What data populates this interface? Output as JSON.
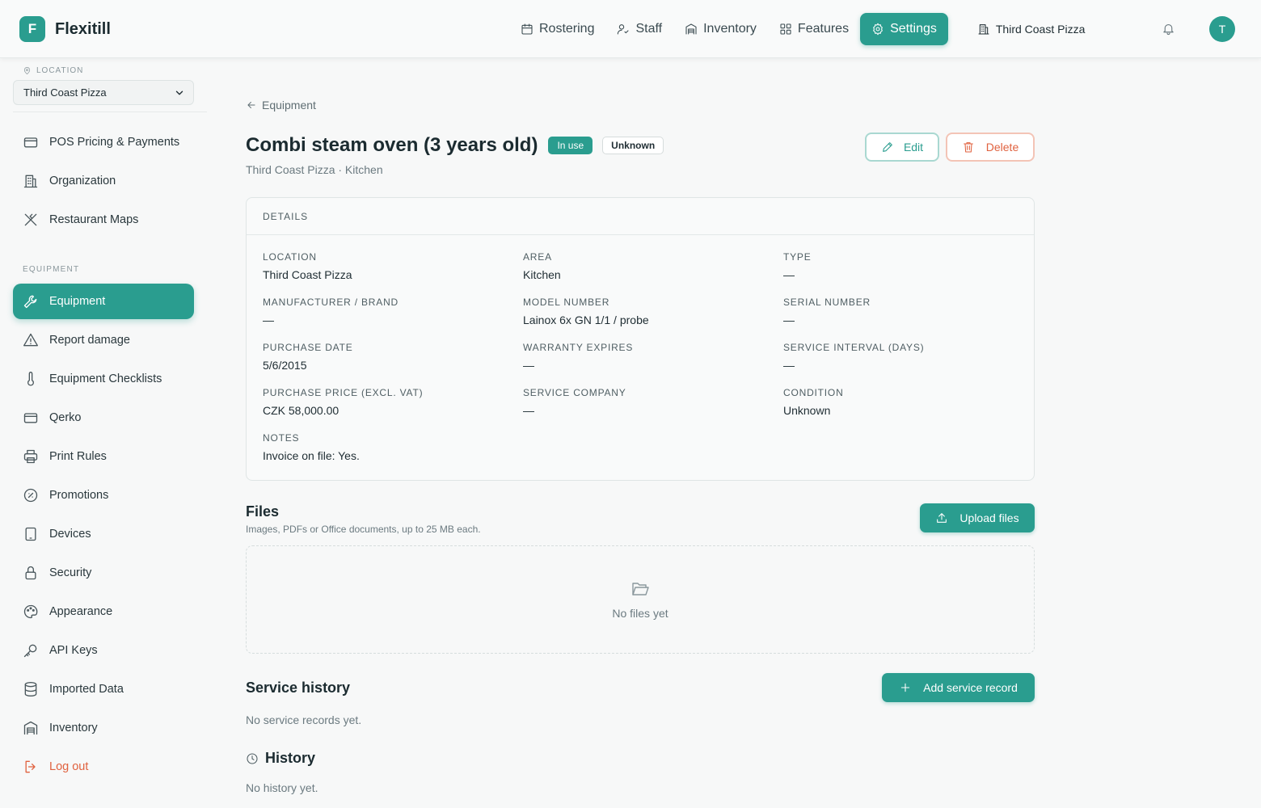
{
  "header": {
    "brand_initial": "F",
    "brand_name": "Flexitill",
    "nav": [
      {
        "label": "Rostering",
        "icon": "calendar-icon"
      },
      {
        "label": "Staff",
        "icon": "staff-icon"
      },
      {
        "label": "Inventory",
        "icon": "warehouse-icon"
      },
      {
        "label": "Features",
        "icon": "grid-icon"
      },
      {
        "label": "Settings",
        "icon": "gear-icon",
        "active": true
      }
    ],
    "location": "Third Coast Pizza",
    "avatar_initial": "T"
  },
  "sidebar": {
    "location_label": "LOCATION",
    "location_value": "Third Coast Pizza",
    "section_label": "EQUIPMENT",
    "items": [
      {
        "label": "POS Pricing & Payments",
        "icon": "credit-card-icon"
      },
      {
        "label": "Organization",
        "icon": "building-icon"
      },
      {
        "label": "Restaurant Maps",
        "icon": "utensils-icon"
      },
      {
        "label": "Equipment",
        "icon": "wrench-icon",
        "active": true
      },
      {
        "label": "Report damage",
        "icon": "warning-icon"
      },
      {
        "label": "Equipment Checklists",
        "icon": "thermometer-icon"
      },
      {
        "label": "Qerko",
        "icon": "card-icon"
      },
      {
        "label": "Print Rules",
        "icon": "printer-icon"
      },
      {
        "label": "Promotions",
        "icon": "promo-icon"
      },
      {
        "label": "Devices",
        "icon": "tablet-icon"
      },
      {
        "label": "Security",
        "icon": "lock-icon"
      },
      {
        "label": "Appearance",
        "icon": "palette-icon"
      },
      {
        "label": "API Keys",
        "icon": "key-icon"
      },
      {
        "label": "Imported Data",
        "icon": "database-icon"
      },
      {
        "label": "Inventory",
        "icon": "warehouse-icon"
      },
      {
        "label": "Log out",
        "icon": "logout-icon"
      }
    ]
  },
  "main": {
    "back_label": "Equipment",
    "title": "Combi steam oven (3 years old)",
    "status_badge": "In use",
    "condition_badge": "Unknown",
    "subtitle": "Third Coast Pizza · Kitchen",
    "edit_label": "Edit",
    "delete_label": "Delete",
    "details": {
      "heading": "DETAILS",
      "fields": [
        {
          "label": "LOCATION",
          "value": "Third Coast Pizza"
        },
        {
          "label": "AREA",
          "value": "Kitchen"
        },
        {
          "label": "TYPE",
          "value": "—"
        },
        {
          "label": "MANUFACTURER / BRAND",
          "value": "—"
        },
        {
          "label": "MODEL NUMBER",
          "value": "Lainox 6x GN 1/1 / probe"
        },
        {
          "label": "SERIAL NUMBER",
          "value": "—"
        },
        {
          "label": "PURCHASE DATE",
          "value": "5/6/2015"
        },
        {
          "label": "WARRANTY EXPIRES",
          "value": "—"
        },
        {
          "label": "SERVICE INTERVAL (DAYS)",
          "value": "—"
        },
        {
          "label": "PURCHASE PRICE (EXCL. VAT)",
          "value": "CZK 58,000.00"
        },
        {
          "label": "SERVICE COMPANY",
          "value": "—"
        },
        {
          "label": "CONDITION",
          "value": "Unknown"
        },
        {
          "label": "NOTES",
          "value": "Invoice on file: Yes."
        }
      ]
    },
    "files": {
      "title": "Files",
      "subtitle": "Images, PDFs or Office documents, up to 25 MB each.",
      "upload_label": "Upload files",
      "empty": "No files yet"
    },
    "service": {
      "title": "Service history",
      "add_label": "Add service record",
      "empty": "No service records yet."
    },
    "history": {
      "title": "History",
      "empty": "No history yet."
    }
  },
  "colors": {
    "accent": "#2a9d8f",
    "danger": "#e0623f",
    "background": "#f7f8f8"
  }
}
